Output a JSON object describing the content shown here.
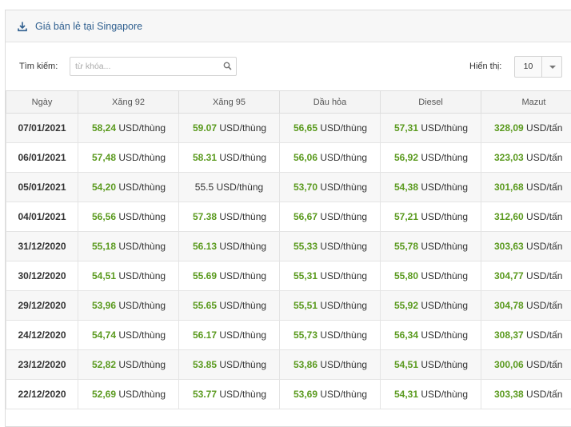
{
  "panel": {
    "title": "Giá bán lẻ tại Singapore"
  },
  "search": {
    "label": "Tìm kiếm:",
    "placeholder": "từ khóa..."
  },
  "page_size": {
    "label": "Hiển thị:",
    "value": "10"
  },
  "table": {
    "headers": [
      "Ngày",
      "Xăng 92",
      "Xăng 95",
      "Dầu hỏa",
      "Diesel",
      "Mazut"
    ],
    "rows": [
      {
        "date": "07/01/2021",
        "x92": "58,24",
        "x92_unit": "USD/thùng",
        "x95": "59.07",
        "x95_unit": "USD/thùng",
        "dau_hoa": "56,65",
        "dau_hoa_unit": "USD/thùng",
        "diesel": "57,31",
        "diesel_unit": "USD/thùng",
        "mazut": "328,09",
        "mazut_unit": "USD/tấn"
      },
      {
        "date": "06/01/2021",
        "x92": "57,48",
        "x92_unit": "USD/thùng",
        "x95": "58.31",
        "x95_unit": "USD/thùng",
        "dau_hoa": "56,06",
        "dau_hoa_unit": "USD/thùng",
        "diesel": "56,92",
        "diesel_unit": "USD/thùng",
        "mazut": "323,03",
        "mazut_unit": "USD/tấn"
      },
      {
        "date": "05/01/2021",
        "x92": "54,20",
        "x92_unit": "USD/thùng",
        "x95": "55.5",
        "x95_unit": "USD/thùng",
        "dau_hoa": "53,70",
        "dau_hoa_unit": "USD/thùng",
        "diesel": "54,38",
        "diesel_unit": "USD/thùng",
        "mazut": "301,68",
        "mazut_unit": "USD/tấn"
      },
      {
        "date": "04/01/2021",
        "x92": "56,56",
        "x92_unit": "USD/thùng",
        "x95": "57.38",
        "x95_unit": "USD/thùng",
        "dau_hoa": "56,67",
        "dau_hoa_unit": "USD/thùng",
        "diesel": "57,21",
        "diesel_unit": "USD/thùng",
        "mazut": "312,60",
        "mazut_unit": "USD/tấn"
      },
      {
        "date": "31/12/2020",
        "x92": "55,18",
        "x92_unit": "USD/thùng",
        "x95": "56.13",
        "x95_unit": "USD/thùng",
        "dau_hoa": "55,33",
        "dau_hoa_unit": "USD/thùng",
        "diesel": "55,78",
        "diesel_unit": "USD/thùng",
        "mazut": "303,63",
        "mazut_unit": "USD/tấn"
      },
      {
        "date": "30/12/2020",
        "x92": "54,51",
        "x92_unit": "USD/thùng",
        "x95": "55.69",
        "x95_unit": "USD/thùng",
        "dau_hoa": "55,31",
        "dau_hoa_unit": "USD/thùng",
        "diesel": "55,80",
        "diesel_unit": "USD/thùng",
        "mazut": "304,77",
        "mazut_unit": "USD/tấn"
      },
      {
        "date": "29/12/2020",
        "x92": "53,96",
        "x92_unit": "USD/thùng",
        "x95": "55.65",
        "x95_unit": "USD/thùng",
        "dau_hoa": "55,51",
        "dau_hoa_unit": "USD/thùng",
        "diesel": "55,92",
        "diesel_unit": "USD/thùng",
        "mazut": "304,78",
        "mazut_unit": "USD/tấn"
      },
      {
        "date": "24/12/2020",
        "x92": "54,74",
        "x92_unit": "USD/thùng",
        "x95": "56.17",
        "x95_unit": "USD/thùng",
        "dau_hoa": "55,73",
        "dau_hoa_unit": "USD/thùng",
        "diesel": "56,34",
        "diesel_unit": "USD/thùng",
        "mazut": "308,37",
        "mazut_unit": "USD/tấn"
      },
      {
        "date": "23/12/2020",
        "x92": "52,82",
        "x92_unit": "USD/thùng",
        "x95": "53.85",
        "x95_unit": "USD/thùng",
        "dau_hoa": "53,86",
        "dau_hoa_unit": "USD/thùng",
        "diesel": "54,51",
        "diesel_unit": "USD/thùng",
        "mazut": "300,06",
        "mazut_unit": "USD/tấn"
      },
      {
        "date": "22/12/2020",
        "x92": "52,69",
        "x92_unit": "USD/thùng",
        "x95": "53.77",
        "x95_unit": "USD/thùng",
        "dau_hoa": "53,69",
        "dau_hoa_unit": "USD/thùng",
        "diesel": "54,31",
        "diesel_unit": "USD/thùng",
        "mazut": "303,38",
        "mazut_unit": "USD/tấn"
      }
    ]
  },
  "colors": {
    "value_green": "#5a9a1e",
    "title_blue": "#2f5f8f",
    "row_stripe": "#f7f7f7"
  },
  "icons": {
    "header": "download-icon",
    "search": "search-icon",
    "dropdown": "caret-down-icon"
  }
}
